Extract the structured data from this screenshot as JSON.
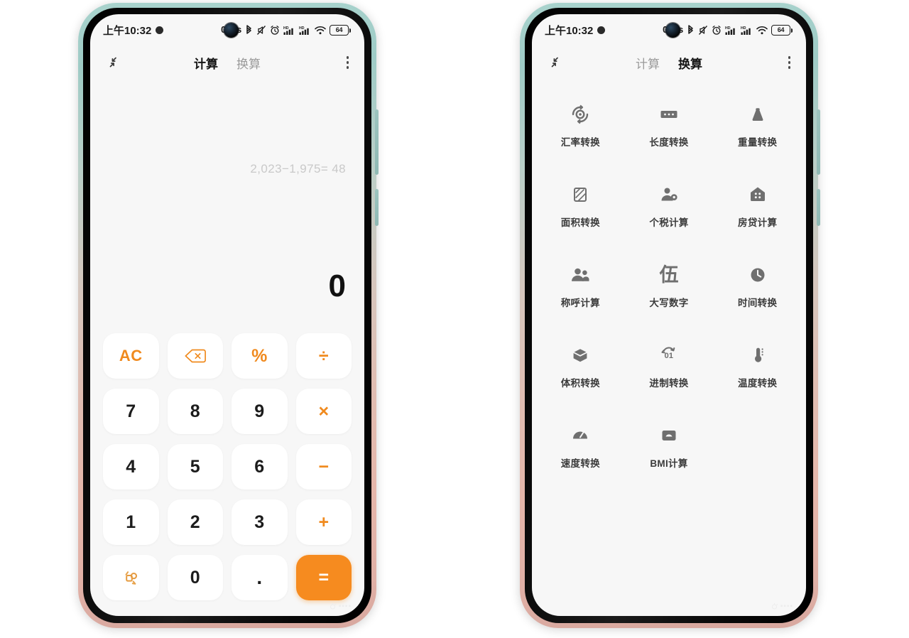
{
  "status_bar": {
    "time": "上午10:32",
    "net_speed": "0 K/s",
    "battery_level": "64",
    "icons": [
      "bluetooth-icon",
      "mute-icon",
      "alarm-icon",
      "signal-hd-1-icon",
      "signal-hd-2-icon",
      "wifi-icon",
      "battery-icon"
    ]
  },
  "app": {
    "shrink_icon": "collapse-icon",
    "menu_icon": "kebab-menu-icon",
    "tabs": [
      {
        "label": "计算",
        "key": "calculator"
      },
      {
        "label": "换算",
        "key": "converter"
      }
    ]
  },
  "calculator": {
    "history": "2,023−1,975= 48",
    "result": "0",
    "keys": [
      {
        "label": "AC",
        "name": "key-all-clear",
        "type": "ac"
      },
      {
        "label": "",
        "name": "key-backspace",
        "type": "icon-backspace"
      },
      {
        "label": "%",
        "name": "key-percent",
        "type": "op"
      },
      {
        "label": "÷",
        "name": "key-divide",
        "type": "op"
      },
      {
        "label": "7",
        "name": "key-7",
        "type": "num"
      },
      {
        "label": "8",
        "name": "key-8",
        "type": "num"
      },
      {
        "label": "9",
        "name": "key-9",
        "type": "num"
      },
      {
        "label": "×",
        "name": "key-multiply",
        "type": "op"
      },
      {
        "label": "4",
        "name": "key-4",
        "type": "num"
      },
      {
        "label": "5",
        "name": "key-5",
        "type": "num"
      },
      {
        "label": "6",
        "name": "key-6",
        "type": "num"
      },
      {
        "label": "−",
        "name": "key-subtract",
        "type": "op"
      },
      {
        "label": "1",
        "name": "key-1",
        "type": "num"
      },
      {
        "label": "2",
        "name": "key-2",
        "type": "num"
      },
      {
        "label": "3",
        "name": "key-3",
        "type": "num"
      },
      {
        "label": "+",
        "name": "key-add",
        "type": "op"
      },
      {
        "label": "",
        "name": "key-scientific",
        "type": "icon-scientific"
      },
      {
        "label": "0",
        "name": "key-0",
        "type": "num"
      },
      {
        "label": ".",
        "name": "key-decimal",
        "type": "dot"
      },
      {
        "label": "=",
        "name": "key-equals",
        "type": "eq"
      }
    ]
  },
  "converter": {
    "items": [
      {
        "label": "汇率转换",
        "icon": "currency-exchange-icon"
      },
      {
        "label": "长度转换",
        "icon": "ruler-icon"
      },
      {
        "label": "重量转换",
        "icon": "weight-icon"
      },
      {
        "label": "面积转换",
        "icon": "area-icon"
      },
      {
        "label": "个税计算",
        "icon": "person-tax-icon"
      },
      {
        "label": "房贷计算",
        "icon": "house-icon"
      },
      {
        "label": "称呼计算",
        "icon": "people-icon"
      },
      {
        "label": "大写数字",
        "icon": "chinese-numeral-icon"
      },
      {
        "label": "时间转换",
        "icon": "clock-icon"
      },
      {
        "label": "体积转换",
        "icon": "cube-icon"
      },
      {
        "label": "进制转换",
        "icon": "binary-icon"
      },
      {
        "label": "温度转换",
        "icon": "thermometer-icon"
      },
      {
        "label": "速度转换",
        "icon": "speedometer-icon"
      },
      {
        "label": "BMI计算",
        "icon": "scale-icon"
      }
    ]
  },
  "colors": {
    "accent": "#f68b1f",
    "key_text": "#1c1c1c",
    "screen_bg": "#f7f7f7"
  }
}
